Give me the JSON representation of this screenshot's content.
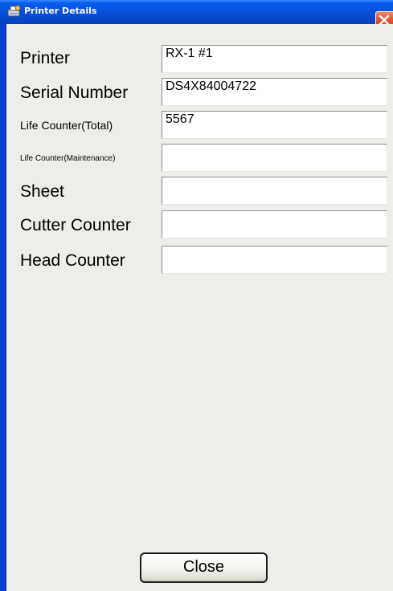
{
  "window": {
    "title": "Printer Details",
    "icon": "printer-settings-icon",
    "close_icon": "close-icon"
  },
  "fields": [
    {
      "label": "Printer",
      "value": "RX-1 #1"
    },
    {
      "label": "Serial Number",
      "value": "DS4X84004722"
    },
    {
      "label": "Life Counter(Total)",
      "value": "5567"
    },
    {
      "label": "Life Counter(Maintenance)",
      "value": ""
    },
    {
      "label": "Sheet",
      "value": ""
    },
    {
      "label": "Cutter Counter",
      "value": ""
    },
    {
      "label": "Head Counter",
      "value": ""
    }
  ],
  "buttons": {
    "close_label": "Close"
  },
  "colors": {
    "titlebar": "#0853e0",
    "close_button": "#e2582d",
    "dialog_background": "#ededea"
  }
}
